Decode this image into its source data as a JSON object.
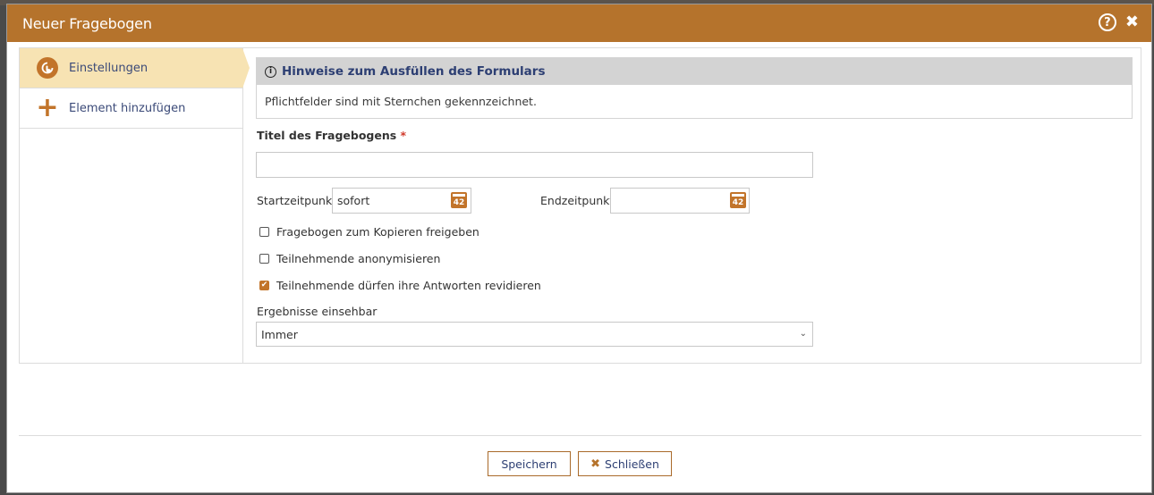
{
  "dialog": {
    "title": "Neuer Fragebogen",
    "help_icon": "question-circle-icon",
    "close_icon": "close-icon"
  },
  "sidebar": {
    "items": [
      {
        "label": "Einstellungen",
        "icon": "settings-hand-icon",
        "active": true
      },
      {
        "label": "Element hinzufügen",
        "icon": "plus-icon",
        "active": false
      }
    ]
  },
  "hint": {
    "title": "Hinweise zum Ausfüllen des Formulars",
    "body": "Pflichtfelder sind mit Sternchen gekennzeichnet."
  },
  "form": {
    "title_label": "Titel des Fragebogens",
    "required_mark": "*",
    "title_value": "",
    "start_label": "Startzeitpunkt",
    "start_value": "sofort",
    "end_label": "Endzeitpunkt",
    "end_value": "",
    "calendar_icon_text": "42",
    "checkboxes": [
      {
        "label": "Fragebogen zum Kopieren freigeben",
        "checked": false
      },
      {
        "label": "Teilnehmende anonymisieren",
        "checked": false
      },
      {
        "label": "Teilnehmende dürfen ihre Antworten revidieren",
        "checked": true
      }
    ],
    "results_label": "Ergebnisse einsehbar",
    "results_value": "Immer"
  },
  "footer": {
    "save_label": "Speichern",
    "close_label": "Schließen"
  },
  "colors": {
    "accent": "#b5732c",
    "sidebar_active": "#f7e3b3",
    "link_text": "#2d3f73"
  }
}
